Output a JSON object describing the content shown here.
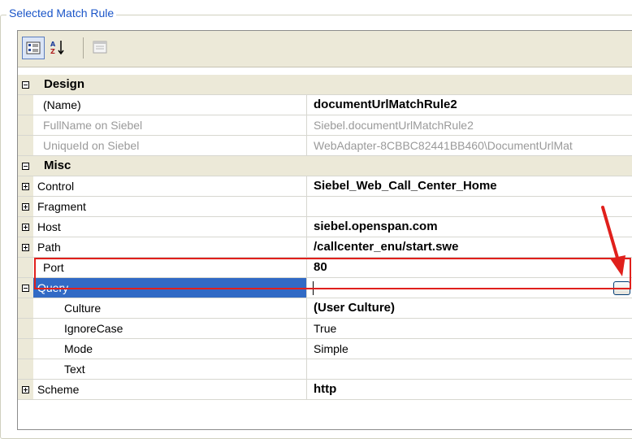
{
  "group_title": "Selected Match Rule",
  "toolbar": {
    "categorized_icon": "categorized-view-icon",
    "alphabetical_icon": "alphabetical-sort-icon",
    "property_pages_icon": "property-pages-icon"
  },
  "categories": {
    "design": "Design",
    "misc": "Misc"
  },
  "properties": {
    "name": {
      "label": "(Name)",
      "value": "documentUrlMatchRule2"
    },
    "fullname": {
      "label": "FullName on Siebel",
      "value": "Siebel.documentUrlMatchRule2"
    },
    "uniqueid": {
      "label": "UniqueId on Siebel",
      "value": "WebAdapter-8CBBC82441BB460\\DocumentUrlMat"
    },
    "control": {
      "label": "Control",
      "value": "Siebel_Web_Call_Center_Home"
    },
    "fragment": {
      "label": "Fragment",
      "value": ""
    },
    "host": {
      "label": "Host",
      "value": "siebel.openspan.com"
    },
    "path": {
      "label": "Path",
      "value": "/callcenter_enu/start.swe"
    },
    "port": {
      "label": "Port",
      "value": "80"
    },
    "query": {
      "label": "Query",
      "value": "",
      "button": "..."
    },
    "culture": {
      "label": "Culture",
      "value": "(User Culture)"
    },
    "ignorecase": {
      "label": "IgnoreCase",
      "value": "True"
    },
    "mode": {
      "label": "Mode",
      "value": "Simple"
    },
    "text": {
      "label": "Text",
      "value": ""
    },
    "scheme": {
      "label": "Scheme",
      "value": "http"
    }
  },
  "colors": {
    "selection": "#316ac5",
    "annotation": "#e0201c",
    "group_title": "#1a55c8"
  }
}
